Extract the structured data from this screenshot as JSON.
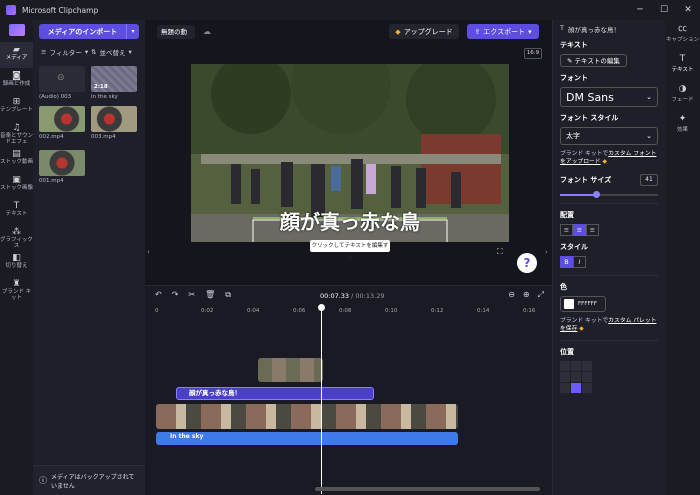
{
  "window": {
    "title": "Microsoft Clipchamp",
    "minimize": "─",
    "maximize": "☐",
    "close": "✕"
  },
  "leftnav": {
    "items": [
      {
        "label": "メディア",
        "icon": "folder-icon"
      },
      {
        "label": "録画と作成",
        "icon": "camera-icon"
      },
      {
        "label": "テンプレート",
        "icon": "templates-icon"
      },
      {
        "label": "音楽とサウンドエフェ",
        "icon": "music-icon"
      },
      {
        "label": "ストック動画",
        "icon": "stock-video-icon"
      },
      {
        "label": "ストック画像",
        "icon": "stock-image-icon"
      },
      {
        "label": "テキスト",
        "icon": "text-icon"
      },
      {
        "label": "グラフィックス",
        "icon": "graphics-icon"
      },
      {
        "label": "切り替え",
        "icon": "transition-icon"
      },
      {
        "label": "ブランド キット",
        "icon": "brand-kit-icon"
      }
    ]
  },
  "media": {
    "import_label": "メディアのインポート",
    "filter_label": "フィルター",
    "sort_label": "並べ替え",
    "items": [
      {
        "name": "(Audio) 003",
        "duration": ""
      },
      {
        "name": "In the sky",
        "duration": "2:18"
      },
      {
        "name": "002.mp4",
        "duration": "0:02"
      },
      {
        "name": "003.mp4",
        "duration": "0:02"
      },
      {
        "name": "001.mp4",
        "duration": "0:02"
      }
    ],
    "backup_text": "メディアはバックアップされていません"
  },
  "preview": {
    "project_name": "無題の動",
    "upgrade_label": "アップグレード",
    "export_label": "エクスポート",
    "ratio": "16:9",
    "caption": "顔が真っ赤な鳥",
    "tooltip": "クリックしてテキストを編集する",
    "help": "?"
  },
  "timeline": {
    "current": "00:07.33",
    "total": "/ 00:13.29",
    "ticks": [
      "0",
      "0:02",
      "0:04",
      "0:06",
      "0:08",
      "0:10",
      "0:12",
      "0:14",
      "0:16"
    ],
    "text_clip": "顔が真っ赤な鳥！",
    "audio_clip": "In the sky"
  },
  "props": {
    "header": "顔が真っ赤な鳥！",
    "text_section": "テキスト",
    "edit_text": "テキストの編集",
    "font_section": "フォント",
    "font_value": "DM Sans",
    "style_section": "フォント スタイル",
    "style_value": "太字",
    "brand_note_pre": "ブランド キットで",
    "brand_note_link": "カスタム フォントをアップロード",
    "size_section": "フォント サイズ",
    "size_value": "41",
    "size_fraction": 0.4,
    "align_section": "配置",
    "style2_section": "スタイル",
    "bold": "B",
    "italic": "I",
    "color_section": "色",
    "color_hex": "FFFFFF",
    "palette_pre": "ブランド キットで",
    "palette_link": "カスタム パレットを保存",
    "position_section": "位置"
  },
  "rightnav": {
    "items": [
      {
        "label": "キャプション",
        "icon": "captions-icon"
      },
      {
        "label": "テキスト",
        "icon": "text-icon"
      },
      {
        "label": "フェード",
        "icon": "fade-icon"
      },
      {
        "label": "効果",
        "icon": "effects-icon"
      }
    ]
  },
  "colors": {
    "accent": "#5b4ee0",
    "audio": "#3f7be8",
    "text_clip": "#4a40c8"
  }
}
